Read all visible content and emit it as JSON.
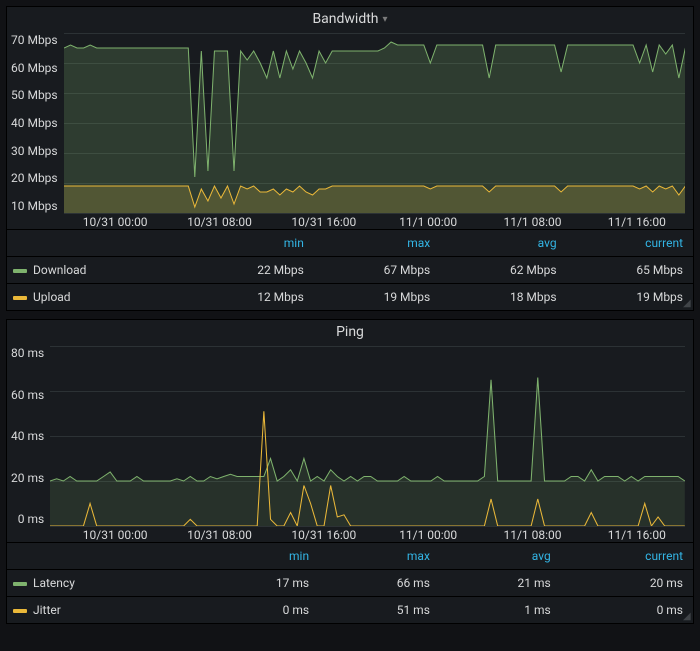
{
  "panels": [
    {
      "title": "Bandwidth",
      "y_axis_unit": "Mbps",
      "y_ticks": [
        70,
        60,
        50,
        40,
        30,
        20,
        10
      ],
      "y_range": [
        10,
        70
      ],
      "x_labels": [
        "10/31 00:00",
        "10/31 08:00",
        "10/31 16:00",
        "11/1 00:00",
        "11/1 08:00",
        "11/1 16:00"
      ],
      "legend_headers": [
        "min",
        "max",
        "avg",
        "current"
      ],
      "series": [
        {
          "name": "Download",
          "color": "#7eb26d",
          "min": "22 Mbps",
          "max": "67 Mbps",
          "avg": "62 Mbps",
          "current": "65 Mbps"
        },
        {
          "name": "Upload",
          "color": "#eab839",
          "min": "12 Mbps",
          "max": "19 Mbps",
          "avg": "18 Mbps",
          "current": "19 Mbps"
        }
      ]
    },
    {
      "title": "Ping",
      "y_axis_unit": "ms",
      "y_ticks": [
        80,
        60,
        40,
        20,
        0
      ],
      "y_range": [
        0,
        80
      ],
      "x_labels": [
        "10/31 00:00",
        "10/31 08:00",
        "10/31 16:00",
        "11/1 00:00",
        "11/1 08:00",
        "11/1 16:00"
      ],
      "legend_headers": [
        "min",
        "max",
        "avg",
        "current"
      ],
      "series": [
        {
          "name": "Latency",
          "color": "#7eb26d",
          "min": "17 ms",
          "max": "66 ms",
          "avg": "21 ms",
          "current": "20 ms"
        },
        {
          "name": "Jitter",
          "color": "#eab839",
          "min": "0 ms",
          "max": "51 ms",
          "avg": "1 ms",
          "current": "0 ms"
        }
      ]
    }
  ],
  "chart_data": [
    {
      "type": "area",
      "title": "Bandwidth",
      "xlabel": "",
      "ylabel": "Mbps",
      "ylim": [
        10,
        70
      ],
      "x": [
        0,
        1,
        2,
        3,
        4,
        5,
        6,
        7,
        8,
        9,
        10,
        11,
        12,
        13,
        14,
        15,
        16,
        17,
        18,
        19,
        20,
        21,
        22,
        23,
        24,
        25,
        26,
        27,
        28,
        29,
        30,
        31,
        32,
        33,
        34,
        35,
        36,
        37,
        38,
        39,
        40,
        41,
        42,
        43,
        44,
        45,
        46,
        47,
        48,
        49,
        50,
        51,
        52,
        53,
        54,
        55,
        56,
        57,
        58,
        59,
        60,
        61,
        62,
        63,
        64,
        65,
        66,
        67,
        68,
        69,
        70,
        71,
        72,
        73,
        74,
        75,
        76,
        77,
        78,
        79,
        80,
        81,
        82,
        83,
        84,
        85,
        86,
        87,
        88,
        89,
        90,
        91,
        92,
        93,
        94,
        95
      ],
      "x_tick_labels": [
        "10/31 00:00",
        "10/31 08:00",
        "10/31 16:00",
        "11/1 00:00",
        "11/1 08:00",
        "11/1 16:00"
      ],
      "series": [
        {
          "name": "Download",
          "color": "#7eb26d",
          "values": [
            65,
            66,
            65,
            65,
            66,
            65,
            65,
            65,
            65,
            65,
            65,
            65,
            65,
            65,
            65,
            65,
            65,
            65,
            65,
            65,
            22,
            64,
            24,
            64,
            64,
            64,
            24,
            64,
            61,
            64,
            60,
            55,
            64,
            55,
            64,
            58,
            64,
            60,
            55,
            64,
            60,
            64,
            64,
            64,
            64,
            64,
            64,
            64,
            64,
            65,
            67,
            66,
            66,
            66,
            66,
            66,
            60,
            66,
            66,
            66,
            66,
            66,
            66,
            66,
            66,
            55,
            66,
            66,
            66,
            66,
            66,
            66,
            66,
            66,
            66,
            66,
            57,
            66,
            66,
            66,
            66,
            66,
            66,
            66,
            66,
            66,
            66,
            66,
            60,
            66,
            57,
            66,
            63,
            66,
            55,
            65
          ]
        },
        {
          "name": "Upload",
          "color": "#eab839",
          "values": [
            19,
            19,
            19,
            19,
            19,
            19,
            19,
            19,
            19,
            19,
            19,
            19,
            19,
            19,
            19,
            19,
            19,
            19,
            19,
            19,
            12,
            18,
            14,
            19,
            15,
            19,
            13,
            19,
            18,
            19,
            17,
            17,
            18,
            16,
            18,
            17,
            19,
            17,
            16,
            18,
            18,
            19,
            19,
            19,
            19,
            19,
            19,
            19,
            19,
            19,
            19,
            19,
            19,
            19,
            19,
            19,
            18,
            19,
            19,
            19,
            19,
            19,
            19,
            19,
            19,
            17,
            19,
            19,
            19,
            19,
            19,
            19,
            19,
            19,
            19,
            19,
            17,
            19,
            19,
            19,
            19,
            19,
            19,
            19,
            19,
            19,
            19,
            19,
            18,
            19,
            17,
            19,
            18,
            19,
            16,
            19
          ]
        }
      ]
    },
    {
      "type": "line",
      "title": "Ping",
      "xlabel": "",
      "ylabel": "ms",
      "ylim": [
        0,
        80
      ],
      "x": [
        0,
        1,
        2,
        3,
        4,
        5,
        6,
        7,
        8,
        9,
        10,
        11,
        12,
        13,
        14,
        15,
        16,
        17,
        18,
        19,
        20,
        21,
        22,
        23,
        24,
        25,
        26,
        27,
        28,
        29,
        30,
        31,
        32,
        33,
        34,
        35,
        36,
        37,
        38,
        39,
        40,
        41,
        42,
        43,
        44,
        45,
        46,
        47,
        48,
        49,
        50,
        51,
        52,
        53,
        54,
        55,
        56,
        57,
        58,
        59,
        60,
        61,
        62,
        63,
        64,
        65,
        66,
        67,
        68,
        69,
        70,
        71,
        72,
        73,
        74,
        75,
        76,
        77,
        78,
        79,
        80,
        81,
        82,
        83,
        84,
        85,
        86,
        87,
        88,
        89,
        90,
        91,
        92,
        93,
        94,
        95
      ],
      "x_tick_labels": [
        "10/31 00:00",
        "10/31 08:00",
        "10/31 16:00",
        "11/1 00:00",
        "11/1 08:00",
        "11/1 16:00"
      ],
      "series": [
        {
          "name": "Latency",
          "color": "#7eb26d",
          "values": [
            20,
            21,
            20,
            22,
            20,
            20,
            20,
            20,
            22,
            24,
            20,
            20,
            20,
            22,
            20,
            20,
            20,
            20,
            20,
            21,
            20,
            22,
            20,
            20,
            22,
            21,
            22,
            23,
            22,
            22,
            22,
            22,
            22,
            30,
            20,
            22,
            25,
            20,
            30,
            20,
            22,
            20,
            25,
            22,
            20,
            22,
            20,
            22,
            22,
            20,
            20,
            20,
            20,
            22,
            20,
            20,
            20,
            20,
            22,
            20,
            20,
            20,
            20,
            20,
            20,
            22,
            65,
            20,
            20,
            20,
            20,
            20,
            20,
            66,
            20,
            20,
            20,
            20,
            22,
            22,
            20,
            25,
            20,
            22,
            22,
            22,
            20,
            22,
            20,
            22,
            22,
            22,
            22,
            22,
            22,
            20
          ]
        },
        {
          "name": "Jitter",
          "color": "#eab839",
          "values": [
            0,
            0,
            0,
            0,
            0,
            0,
            10,
            0,
            0,
            0,
            0,
            0,
            0,
            0,
            0,
            0,
            0,
            0,
            0,
            0,
            0,
            3,
            0,
            0,
            0,
            0,
            0,
            0,
            0,
            0,
            0,
            0,
            51,
            3,
            0,
            0,
            6,
            0,
            18,
            10,
            0,
            0,
            18,
            4,
            5,
            0,
            0,
            0,
            0,
            0,
            0,
            0,
            0,
            0,
            0,
            0,
            0,
            0,
            0,
            0,
            0,
            0,
            0,
            0,
            0,
            0,
            12,
            0,
            0,
            0,
            0,
            0,
            0,
            12,
            0,
            0,
            0,
            0,
            0,
            0,
            0,
            6,
            0,
            0,
            0,
            0,
            0,
            0,
            0,
            10,
            0,
            4,
            0,
            0,
            0,
            0
          ]
        }
      ]
    }
  ]
}
